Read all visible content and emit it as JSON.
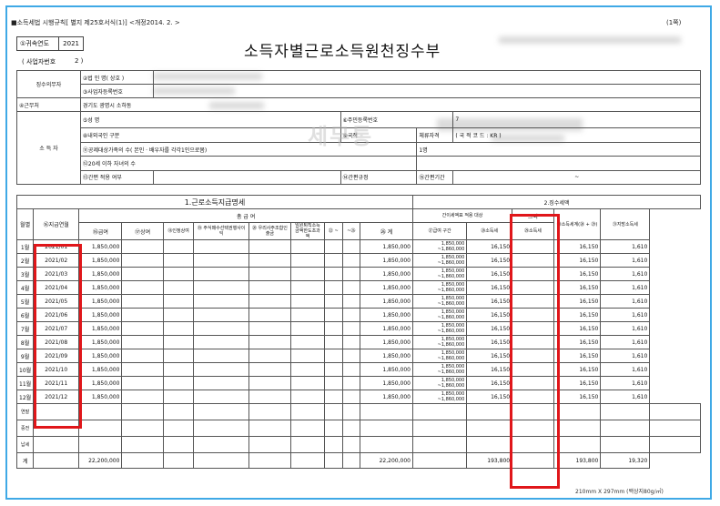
{
  "header": {
    "left_note": "■소득세법 시행규칙[ 별지 제25호서식(1)] <개정2014. 2. >",
    "right_note": "(1쪽)",
    "year_label": "①귀속연도",
    "year_value": "2021",
    "title": "소득자별근로소득원천징수부",
    "seq_label": "( 사업자번호",
    "seq_value": "2          )"
  },
  "withholder": {
    "section_label": "징수의무자",
    "name_label": "②법 인 명( 상호 )",
    "biz_label": "③사업자등록번호",
    "workplace_label": "④근무처",
    "workplace_value": "경기도 광명시 소하동"
  },
  "earner": {
    "section_label": "소 득 자",
    "name_label": "⑤성     명",
    "id_label": "⑥주민등록번호",
    "id_value": "7",
    "foreign_label": "⑧내외국인 구분",
    "nation_label": "⑨국적",
    "residence_label": "체류자격",
    "residence_value": "( 국 적 코 드 :        KR      )",
    "dependents_label": "⑪공제대상가족의 수( 본인 · 배우자를 각각1인으로봄)",
    "dependents_value": "1명",
    "children_label": "⑫20세 이하 자녀의 수",
    "simple_label": "⑬간편 적용 여부",
    "rule_label": "⑭간편규정",
    "period_label": "⑮간편기간",
    "period_value": "~"
  },
  "watermark": "세무통",
  "section1_title": "1.근로소득지급명세",
  "section2_title": "2.징수세액",
  "columns": {
    "month": "월별",
    "pay_month": "⑯지급연월",
    "payment_group": "총     급     여",
    "salary": "⑯급여",
    "bonus": "⑰상여",
    "recognized_bonus": "⑱인정상여",
    "stock_option": "⑲ 주식매수선택권행사이익",
    "esop": "⑳ 우리사주조합인출금",
    "exec_retire": "임원퇴직소득금액한도초과액",
    "c22": "㉒ ~",
    "c26": "~㉖",
    "total": "㉖ 계",
    "simplified": "간이세액표 적용 대상",
    "pay_range": "㉗급여 구간",
    "income_tax": "㉘소득세",
    "other": "그외",
    "other_income_tax": "㉙소득세",
    "income_tax_sum": "㉚소득세계(㉘ + ㉙)",
    "local_tax": "㉛지방소득세"
  },
  "rows": [
    {
      "month": "1월",
      "pay_month": "2021/01",
      "salary": "1,850,000",
      "total": "1,850,000",
      "range_low": "1,850,000",
      "range_high": "~1,860,000",
      "income_tax": "16,150",
      "tax_sum": "16,150",
      "local_tax": "1,610"
    },
    {
      "month": "2월",
      "pay_month": "2021/02",
      "salary": "1,850,000",
      "total": "1,850,000",
      "range_low": "1,850,000",
      "range_high": "~1,860,000",
      "income_tax": "16,150",
      "tax_sum": "16,150",
      "local_tax": "1,610"
    },
    {
      "month": "3월",
      "pay_month": "2021/03",
      "salary": "1,850,000",
      "total": "1,850,000",
      "range_low": "1,850,000",
      "range_high": "~1,860,000",
      "income_tax": "16,150",
      "tax_sum": "16,150",
      "local_tax": "1,610"
    },
    {
      "month": "4월",
      "pay_month": "2021/04",
      "salary": "1,850,000",
      "total": "1,850,000",
      "range_low": "1,850,000",
      "range_high": "~1,860,000",
      "income_tax": "16,150",
      "tax_sum": "16,150",
      "local_tax": "1,610"
    },
    {
      "month": "5월",
      "pay_month": "2021/05",
      "salary": "1,850,000",
      "total": "1,850,000",
      "range_low": "1,850,000",
      "range_high": "~1,860,000",
      "income_tax": "16,150",
      "tax_sum": "16,150",
      "local_tax": "1,610"
    },
    {
      "month": "6월",
      "pay_month": "2021/06",
      "salary": "1,850,000",
      "total": "1,850,000",
      "range_low": "1,850,000",
      "range_high": "~1,860,000",
      "income_tax": "16,150",
      "tax_sum": "16,150",
      "local_tax": "1,610"
    },
    {
      "month": "7월",
      "pay_month": "2021/07",
      "salary": "1,850,000",
      "total": "1,850,000",
      "range_low": "1,850,000",
      "range_high": "~1,860,000",
      "income_tax": "16,150",
      "tax_sum": "16,150",
      "local_tax": "1,610"
    },
    {
      "month": "8월",
      "pay_month": "2021/08",
      "salary": "1,850,000",
      "total": "1,850,000",
      "range_low": "1,850,000",
      "range_high": "~1,860,000",
      "income_tax": "16,150",
      "tax_sum": "16,150",
      "local_tax": "1,610"
    },
    {
      "month": "9월",
      "pay_month": "2021/09",
      "salary": "1,850,000",
      "total": "1,850,000",
      "range_low": "1,850,000",
      "range_high": "~1,860,000",
      "income_tax": "16,150",
      "tax_sum": "16,150",
      "local_tax": "1,610"
    },
    {
      "month": "10월",
      "pay_month": "2021/10",
      "salary": "1,850,000",
      "total": "1,850,000",
      "range_low": "1,850,000",
      "range_high": "~1,860,000",
      "income_tax": "16,150",
      "tax_sum": "16,150",
      "local_tax": "1,610"
    },
    {
      "month": "11월",
      "pay_month": "2021/11",
      "salary": "1,850,000",
      "total": "1,850,000",
      "range_low": "1,850,000",
      "range_high": "~1,860,000",
      "income_tax": "16,150",
      "tax_sum": "16,150",
      "local_tax": "1,610"
    },
    {
      "month": "12월",
      "pay_month": "2021/12",
      "salary": "1,850,000",
      "total": "1,850,000",
      "range_low": "1,850,000",
      "range_high": "~1,860,000",
      "income_tax": "16,150",
      "tax_sum": "16,150",
      "local_tax": "1,610"
    }
  ],
  "extra_rows": [
    "연말",
    "중전",
    "납세"
  ],
  "totals": {
    "label": "계",
    "salary": "22,200,000",
    "total": "22,200,000",
    "income_tax": "193,800",
    "tax_sum": "193,800",
    "local_tax": "19,320"
  },
  "footer": "210mm X 297mm (백상지80g/㎡)",
  "highlight_color": "#e0161a",
  "frame_color": "#3fa9e6"
}
